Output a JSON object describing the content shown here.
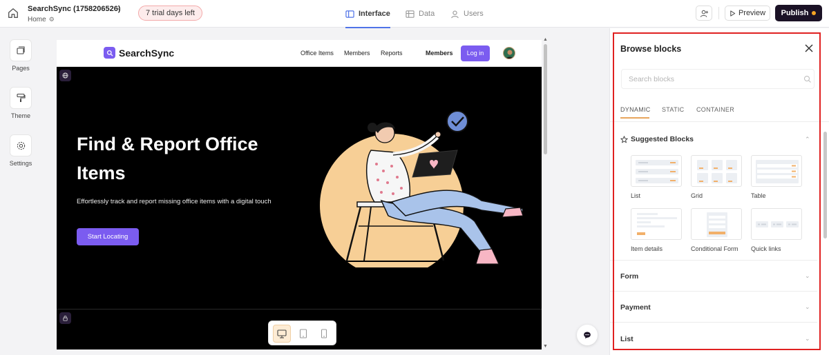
{
  "topbar": {
    "app_name": "SearchSync (1758206526)",
    "page_name": "Home",
    "trial_badge": "7 trial days left",
    "tabs": [
      {
        "label": "Interface",
        "icon": "layout-icon",
        "active": true
      },
      {
        "label": "Data",
        "icon": "table-icon",
        "active": false
      },
      {
        "label": "Users",
        "icon": "user-icon",
        "active": false
      }
    ],
    "preview_label": "Preview",
    "publish_label": "Publish",
    "publish_dot_color": "#f5a524"
  },
  "rail": [
    {
      "label": "Pages",
      "icon": "pages-icon"
    },
    {
      "label": "Theme",
      "icon": "paint-roller-icon"
    },
    {
      "label": "Settings",
      "icon": "gear-icon"
    }
  ],
  "site": {
    "logo_text": "SearchSync",
    "nav_links": [
      "Office Items",
      "Members",
      "Reports"
    ],
    "nav_members": "Members",
    "login_label": "Log in",
    "hero_title": "Find & Report Office Items",
    "hero_subtitle": "Effortlessly track and report missing office items with a digital touch",
    "hero_cta": "Start Locating",
    "accent_color": "#7b5cf0"
  },
  "device_modes": [
    {
      "icon": "desktop-icon",
      "active": true
    },
    {
      "icon": "tablet-icon",
      "active": false
    },
    {
      "icon": "mobile-icon",
      "active": false
    }
  ],
  "panel": {
    "title": "Browse blocks",
    "search_placeholder": "Search blocks",
    "tabs": [
      "DYNAMIC",
      "STATIC",
      "CONTAINER"
    ],
    "suggested_title": "Suggested Blocks",
    "blocks": [
      "List",
      "Grid",
      "Table",
      "Item details",
      "Conditional Form",
      "Quick links"
    ],
    "sections": [
      "Form",
      "Payment",
      "List"
    ]
  }
}
